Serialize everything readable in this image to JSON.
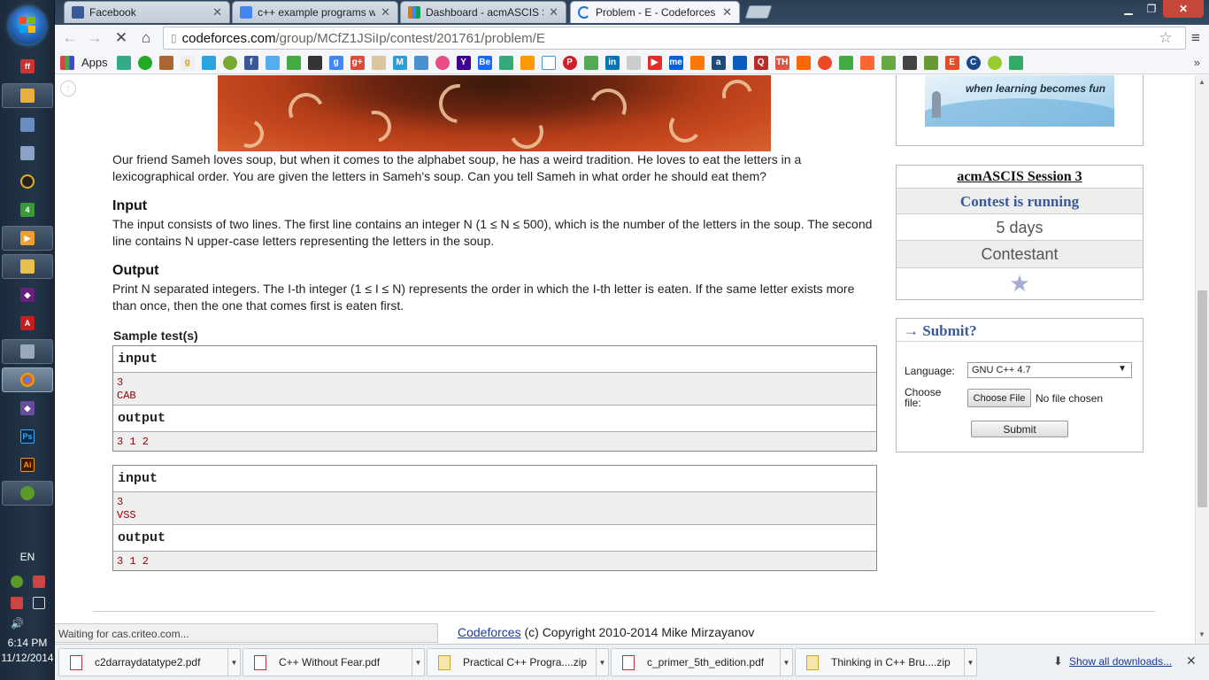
{
  "taskbar": {
    "language": "EN",
    "time": "6:14 PM",
    "date": "11/12/2014"
  },
  "tabs": [
    {
      "title": "Facebook",
      "color": "#3b5998"
    },
    {
      "title": "c++ example programs wi",
      "color": "#4285f4"
    },
    {
      "title": "Dashboard - acmASCIS Se",
      "color": "#e37400"
    },
    {
      "title": "Problem - E - Codeforces",
      "color": "#1a73e8"
    }
  ],
  "address": {
    "host": "codeforces.com",
    "path": "/group/MCfZ1JSiIp/contest/201761/problem/E"
  },
  "bookmarks": {
    "apps_label": "Apps"
  },
  "problem": {
    "statement": "Our friend Sameh loves soup, but when it comes to the alphabet soup, he has a weird tradition. He loves to eat the letters in a lexicographical order. You are given the letters in Sameh's soup. Can you tell Sameh in what order he should eat them?",
    "input_title": "Input",
    "input_text": "The input consists of two lines. The first line contains an integer N (1 ≤ N ≤ 500), which is the number of the letters in the soup. The second line contains N upper-case letters representing the letters in the soup.",
    "output_title": "Output",
    "output_text": "Print N separated integers. The I-th integer (1 ≤ I ≤ N) represents the order in which the I-th letter is eaten. If the same letter exists more than once, then the one that comes first is eaten first.",
    "sample_title": "Sample test(s)",
    "samples": [
      {
        "input_label": "input",
        "input": [
          "3",
          "CAB"
        ],
        "output_label": "output",
        "output": "3 1 2"
      },
      {
        "input_label": "input",
        "input": [
          "3",
          "VSS"
        ],
        "output_label": "output",
        "output": "3 1 2"
      }
    ]
  },
  "sidebar": {
    "ad_slogan": "when learning becomes fun",
    "session": {
      "title": "acmASCIS Session 3",
      "status": "Contest is running",
      "time_left": "5 days",
      "role": "Contestant"
    },
    "submit": {
      "title": "→ Submit?",
      "language_label": "Language:",
      "language_value": "GNU C++ 4.7",
      "file_label": "Choose file:",
      "choose_button": "Choose File",
      "no_file": "No file chosen",
      "submit_button": "Submit"
    }
  },
  "footer": {
    "link": "Codeforces",
    "text": " (c) Copyright 2010-2014 Mike Mirzayanov"
  },
  "status_text": "Waiting for cas.criteo.com...",
  "downloads": [
    {
      "name": "c2darraydatatype2.pdf",
      "kind": "pdf"
    },
    {
      "name": "C++ Without Fear.pdf",
      "kind": "pdf"
    },
    {
      "name": "Practical C++ Progra....zip",
      "kind": "zip"
    },
    {
      "name": "c_primer_5th_edition.pdf",
      "kind": "pdf"
    },
    {
      "name": "Thinking in C++ Bru....zip",
      "kind": "zip"
    }
  ],
  "show_all_downloads": "Show all downloads..."
}
